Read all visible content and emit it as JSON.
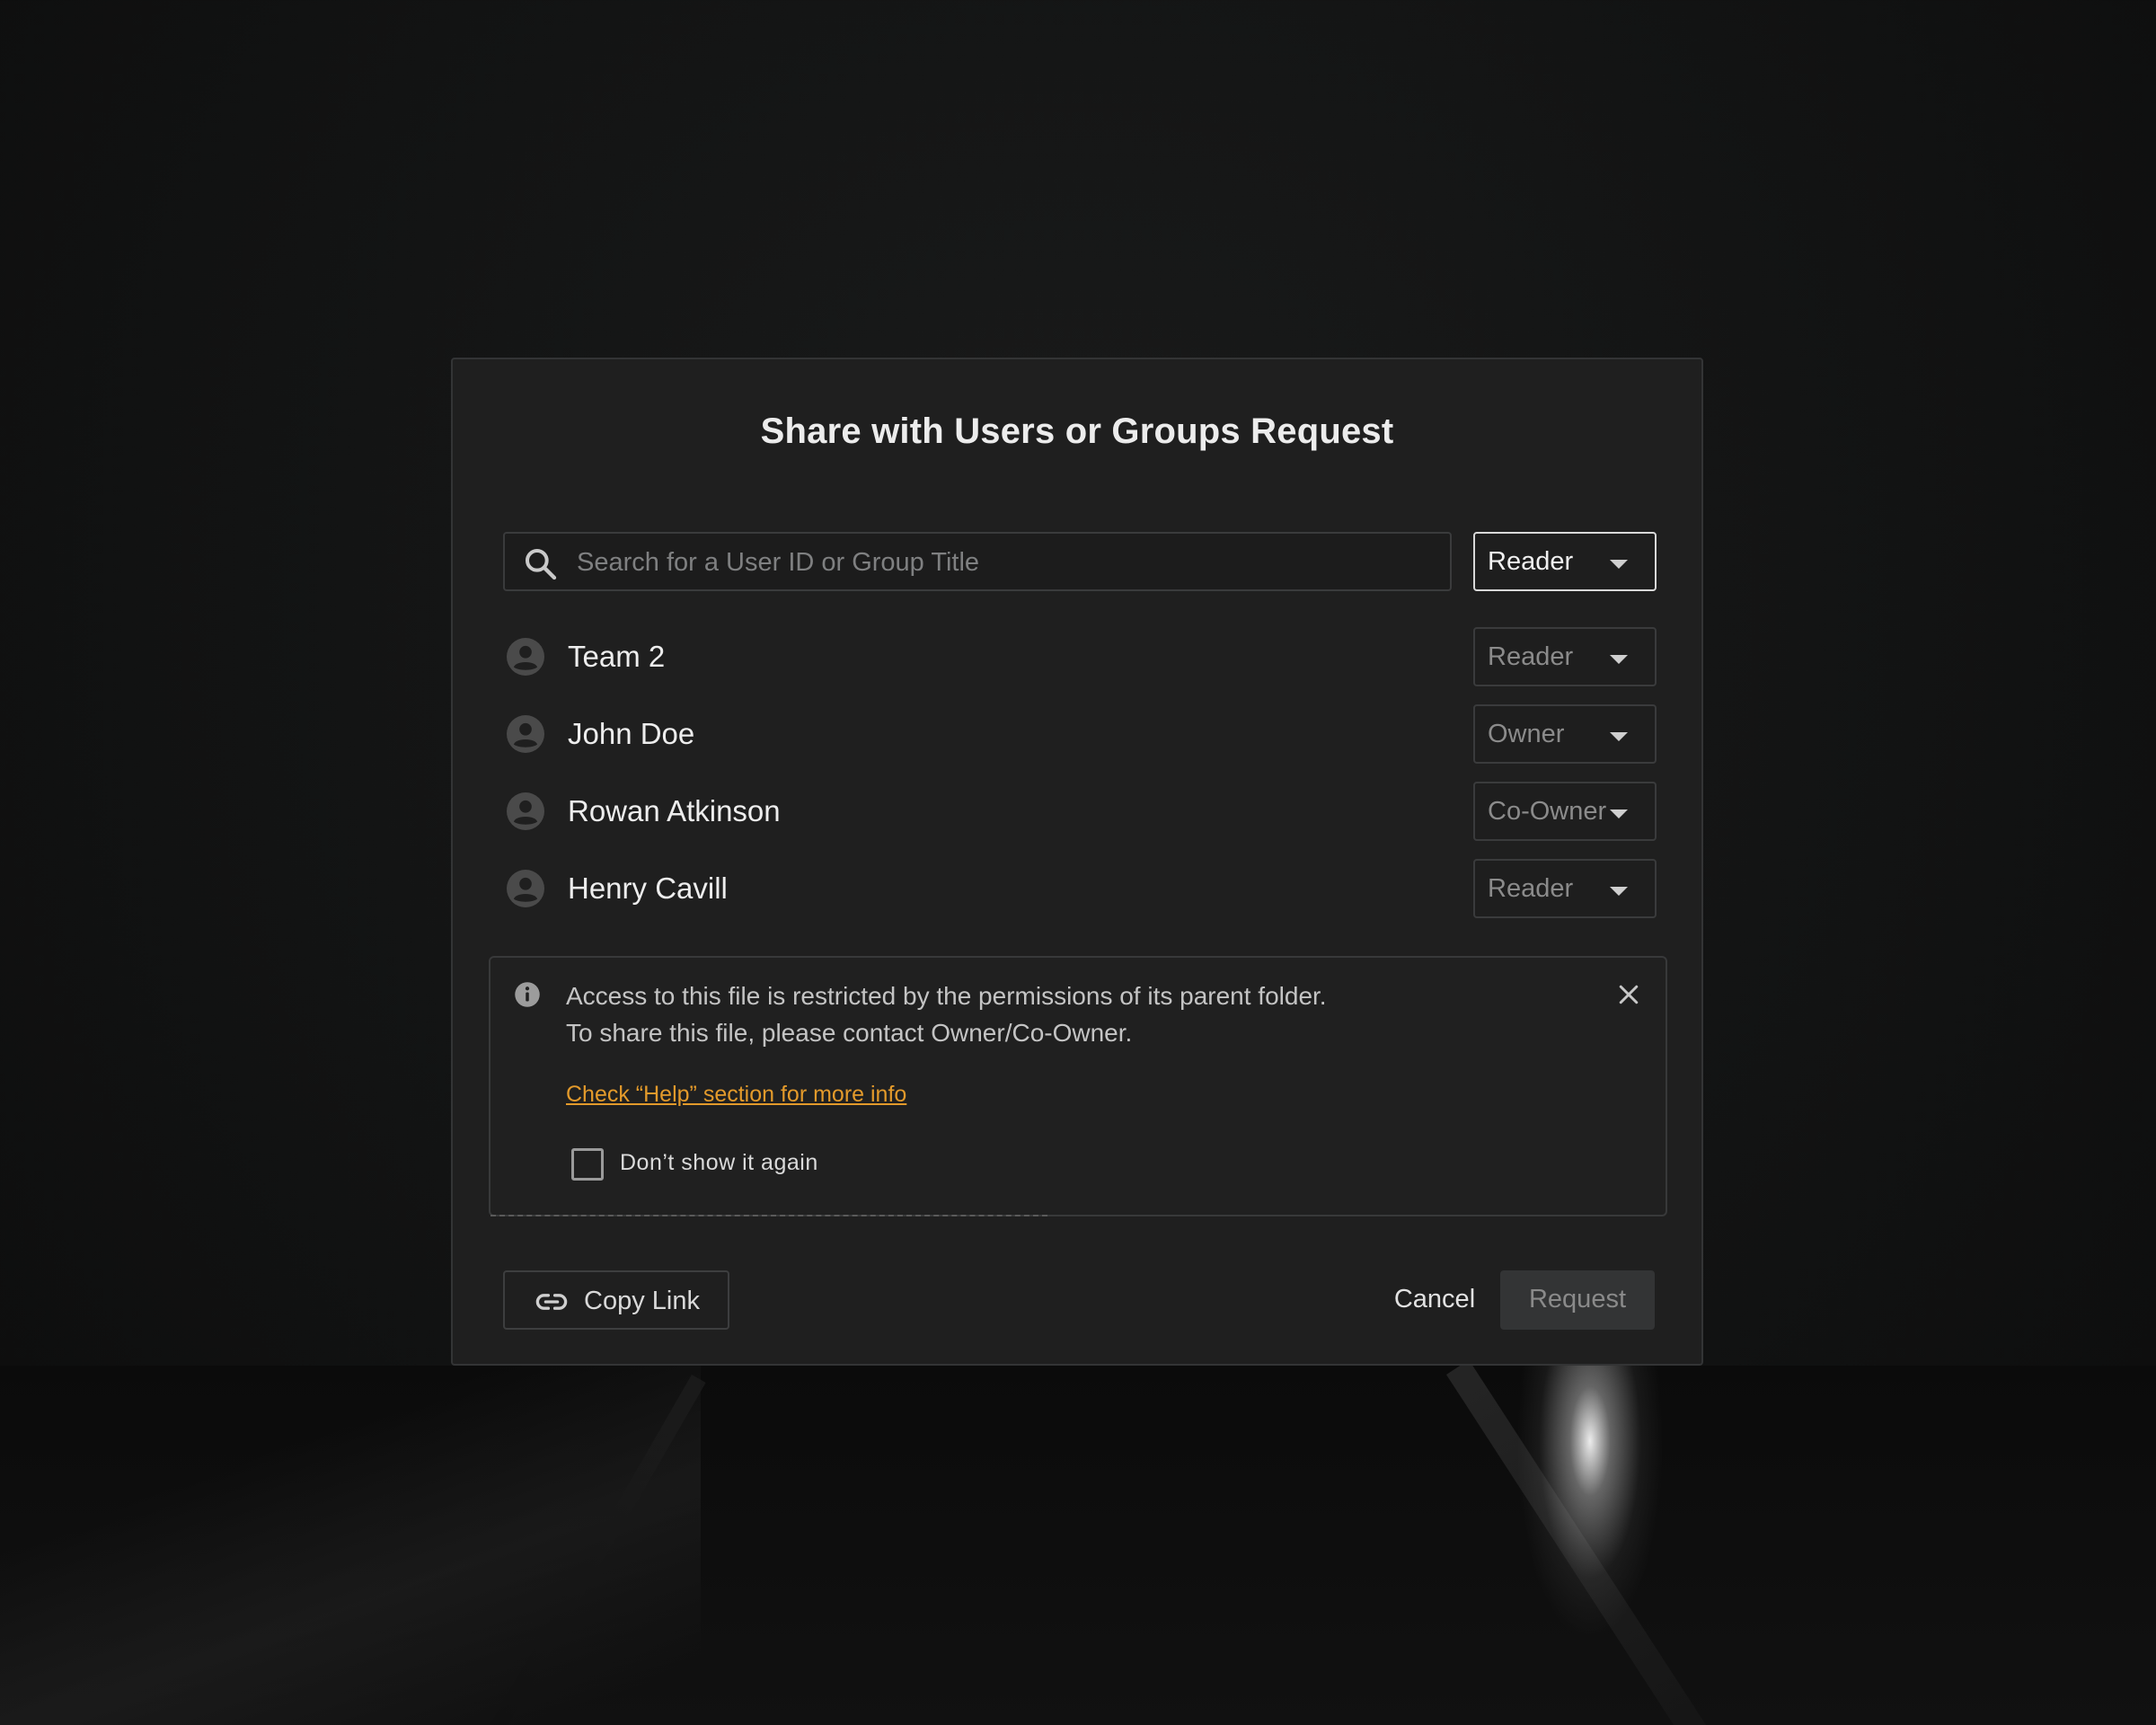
{
  "dialog": {
    "title": "Share with Users or Groups Request"
  },
  "search": {
    "placeholder": "Search for a User ID or Group Title",
    "value": "",
    "role_select": "Reader"
  },
  "members": [
    {
      "name": "Team 2",
      "role": "Reader"
    },
    {
      "name": "John Doe",
      "role": "Owner"
    },
    {
      "name": "Rowan Atkinson",
      "role": "Co-Owner"
    },
    {
      "name": "Henry Cavill",
      "role": "Reader"
    }
  ],
  "notice": {
    "line1": "Access to this file is restricted by the permissions of its parent folder.",
    "line2": "To share this file, please contact Owner/Co-Owner.",
    "help_link": "Check “Help” section for more info",
    "checkbox_label": "Don’t show it again",
    "checkbox_checked": false
  },
  "footer": {
    "copy_link_label": "Copy Link",
    "cancel_label": "Cancel",
    "request_label": "Request"
  },
  "icons": {
    "search": "search-icon",
    "caret": "chevron-down-icon",
    "avatar": "person-avatar-icon",
    "info": "info-icon",
    "close": "close-icon",
    "link": "link-icon"
  },
  "colors": {
    "dialog_bg": "#1f1f1f",
    "link_accent": "#e39a2b",
    "request_disabled_bg": "#333435"
  }
}
